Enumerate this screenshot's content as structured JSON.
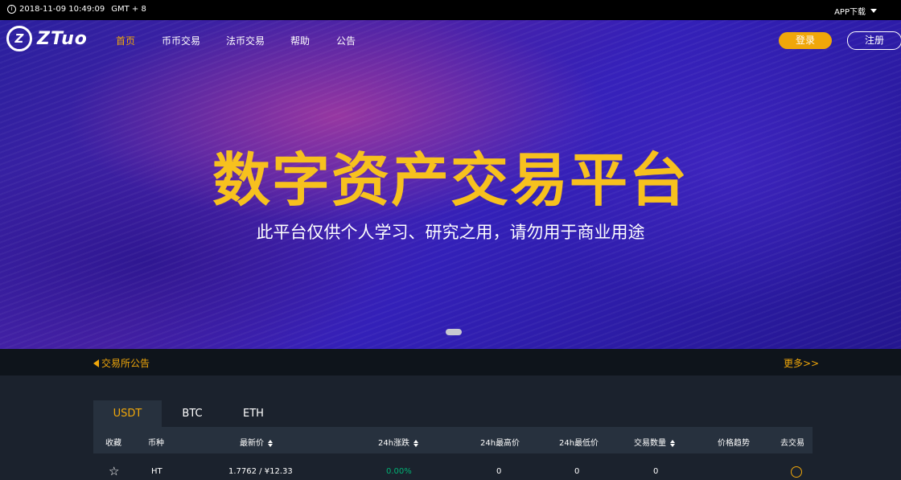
{
  "topbar": {
    "datetime": "2018-11-09 10:49:09",
    "timezone": "GMT + 8",
    "app_download": "APP下载"
  },
  "header": {
    "logo_mark": "Z",
    "logo_text": "ZTuo",
    "nav": [
      "首页",
      "币币交易",
      "法币交易",
      "帮助",
      "公告"
    ],
    "active_nav": "首页",
    "login_label": "登录",
    "register_label": "注册"
  },
  "hero": {
    "title": "数字资产交易平台",
    "subtitle": "此平台仅供个人学习、研究之用，请勿用于商业用途"
  },
  "notice": {
    "label": "交易所公告",
    "more": "更多>>"
  },
  "market": {
    "tabs": [
      "USDT",
      "BTC",
      "ETH"
    ],
    "active_tab": "USDT",
    "columns": [
      "收藏",
      "币种",
      "最新价",
      "24h涨跌",
      "24h最高价",
      "24h最低价",
      "交易数量",
      "价格趋势",
      "去交易"
    ],
    "rows": [
      {
        "coin": "HT",
        "price": "1.7762 / ¥12.33",
        "change": "0.00%",
        "high": "0",
        "low": "0",
        "volume": "0"
      }
    ]
  },
  "colors": {
    "accent": "#f0a70a",
    "positive": "#00b275",
    "hero_title": "#f7c11e",
    "panel": "#27313e",
    "bg": "#1b222d"
  }
}
